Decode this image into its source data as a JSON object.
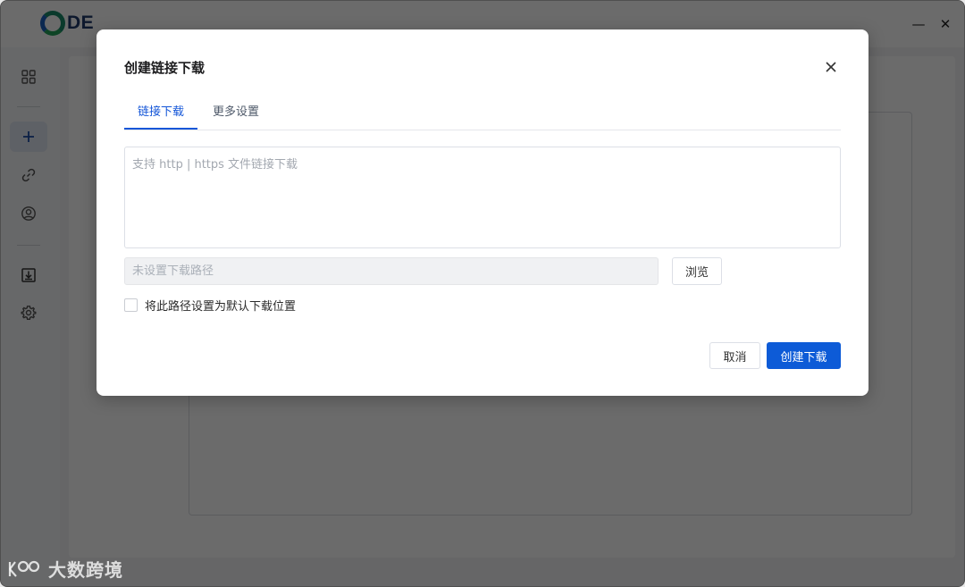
{
  "app": {
    "logo_text": "DE"
  },
  "window_controls": {
    "minimize": "—",
    "close": "✕"
  },
  "sidebar": {
    "items": [
      {
        "icon": "grid-icon"
      },
      {
        "icon": "plus-icon",
        "active": true
      },
      {
        "icon": "link-icon"
      },
      {
        "icon": "user-icon"
      },
      {
        "icon": "download-icon"
      },
      {
        "icon": "gear-icon"
      }
    ]
  },
  "dialog": {
    "title": "创建链接下载",
    "close_glyph": "✕",
    "tabs": [
      {
        "label": "链接下载",
        "active": true
      },
      {
        "label": "更多设置",
        "active": false
      }
    ],
    "url_placeholder": "支持 http | https 文件链接下载",
    "path_placeholder": "未设置下载路径",
    "browse_label": "浏览",
    "default_checkbox_label": "将此路径设置为默认下载位置",
    "default_checked": false,
    "cancel_label": "取消",
    "create_label": "创建下载"
  },
  "watermark": {
    "text": "大数跨境"
  },
  "colors": {
    "accent": "#0d5bd7",
    "tab_active": "#1456d8",
    "overlay": "rgba(0,0,0,0.58)"
  }
}
